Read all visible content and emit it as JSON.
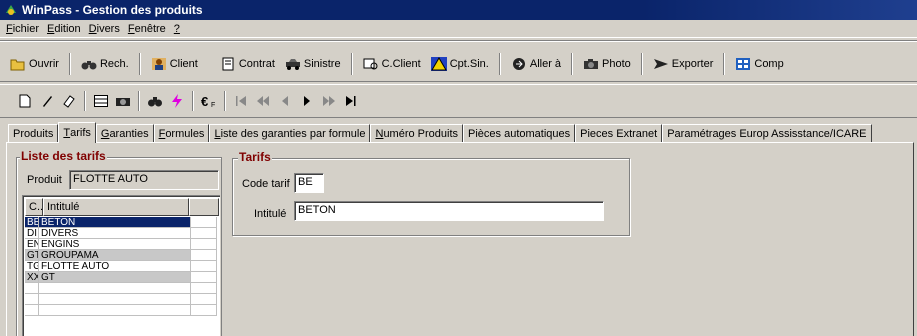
{
  "window": {
    "title": "WinPass - Gestion des produits"
  },
  "menu": [
    {
      "u": "F",
      "rest": "ichier"
    },
    {
      "u": "E",
      "rest": "dition"
    },
    {
      "u": "D",
      "rest": "ivers"
    },
    {
      "u": "F",
      "rest": "enêtre"
    },
    {
      "u": "?",
      "rest": ""
    }
  ],
  "toolbar": {
    "ouvrir": "Ouvrir",
    "rech": "Rech.",
    "client": "Client",
    "contrat": "Contrat",
    "sinistre": "Sinistre",
    "c_client": "C.Client",
    "cpt_sin": "Cpt.Sin.",
    "aller_a": "Aller à",
    "photo": "Photo",
    "exporter": "Exporter",
    "comp": "Comp"
  },
  "tabs": [
    {
      "u": "",
      "label": "Produits"
    },
    {
      "u": "T",
      "label": "arifs"
    },
    {
      "u": "G",
      "label": "aranties"
    },
    {
      "u": "F",
      "label": "ormules"
    },
    {
      "u": "L",
      "label": "iste des garanties par formule"
    },
    {
      "u": "N",
      "label": "uméro Produits"
    },
    {
      "u": "",
      "label": "Pièces automatiques"
    },
    {
      "u": "",
      "label": "Pieces Extranet"
    },
    {
      "u": "",
      "label": "Paramétrages Europ Assisstance/ICARE"
    }
  ],
  "liste": {
    "legend": "Liste des tarifs",
    "produit_label": "Produit",
    "produit_value": "FLOTTE AUTO",
    "col_code": "C...",
    "col_intitule": "Intitulé",
    "rows": [
      {
        "code": "BE",
        "label": "BETON"
      },
      {
        "code": "DI",
        "label": "DIVERS"
      },
      {
        "code": "EN",
        "label": "ENGINS"
      },
      {
        "code": "GT",
        "label": "GROUPAMA"
      },
      {
        "code": "TG",
        "label": "FLOTTE AUTO"
      },
      {
        "code": "XX",
        "label": "GT"
      }
    ]
  },
  "tarifs": {
    "legend": "Tarifs",
    "code_label": "Code tarif",
    "code_value": "BE",
    "intitule_label": "Intitulé",
    "intitule_value": "BETON"
  }
}
